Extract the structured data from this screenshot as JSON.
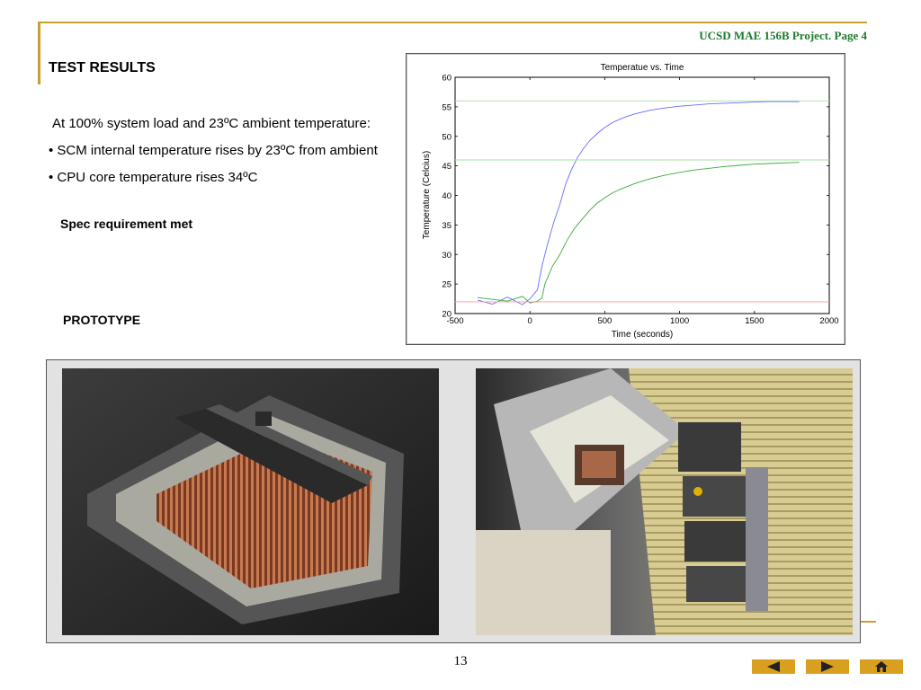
{
  "header": {
    "text": "UCSD MAE 156B Project. Page 4"
  },
  "title": "TEST RESULTS",
  "body": {
    "intro": "At 100% system load and 23ºC ambient temperature:",
    "bullet1": "•   SCM internal temperature  rises by 23ºC from ambient",
    "bullet2": "•   CPU core  temperature rises 34ºC",
    "spec": "Spec requirement met",
    "prototype": "PROTOTYPE"
  },
  "footer": {
    "page_number": "13"
  },
  "nav": {
    "prev_icon": "triangle-left-icon",
    "next_icon": "triangle-right-icon",
    "home_icon": "home-icon"
  },
  "photos": [
    {
      "subject": "copper-finned-heat-sink"
    },
    {
      "subject": "server-rack-module"
    }
  ],
  "chart_data": {
    "type": "line",
    "title": "Temperatue vs. Time",
    "xlabel": "Time (seconds)",
    "ylabel": "Temperature (Celcius)",
    "xlim": [
      -500,
      2000
    ],
    "ylim": [
      20,
      60
    ],
    "xticks": [
      -500,
      0,
      500,
      1000,
      1500,
      2000
    ],
    "yticks": [
      20,
      25,
      30,
      35,
      40,
      45,
      50,
      55,
      60
    ],
    "grid": false,
    "series": [
      {
        "color": "#6a6aff",
        "x": [
          -350,
          -250,
          -150,
          -50,
          0,
          50,
          80,
          120,
          160,
          200,
          240,
          280,
          320,
          360,
          400,
          450,
          500,
          550,
          600,
          650,
          700,
          750,
          800,
          900,
          1000,
          1100,
          1200,
          1300,
          1400,
          1500,
          1600,
          1700,
          1800
        ],
        "y": [
          22.3,
          21.6,
          22.8,
          21.5,
          22.5,
          24.0,
          28.0,
          32.0,
          35.5,
          38.5,
          42.0,
          44.5,
          46.5,
          48.0,
          49.3,
          50.5,
          51.5,
          52.3,
          52.9,
          53.4,
          53.8,
          54.1,
          54.4,
          54.8,
          55.1,
          55.3,
          55.5,
          55.6,
          55.7,
          55.8,
          55.9,
          55.9,
          55.9
        ]
      },
      {
        "color": "#3aa83a",
        "x": [
          -350,
          -250,
          -150,
          -50,
          0,
          50,
          80,
          100,
          150,
          200,
          250,
          300,
          350,
          400,
          450,
          500,
          550,
          600,
          650,
          700,
          750,
          800,
          900,
          1000,
          1100,
          1200,
          1300,
          1400,
          1500,
          1600,
          1700,
          1800
        ],
        "y": [
          22.7,
          22.4,
          22.1,
          22.9,
          21.8,
          22.1,
          22.6,
          25.0,
          28.0,
          30.0,
          32.5,
          34.5,
          36.0,
          37.5,
          38.7,
          39.6,
          40.4,
          41.0,
          41.5,
          42.0,
          42.4,
          42.8,
          43.4,
          43.9,
          44.3,
          44.6,
          44.9,
          45.1,
          45.3,
          45.4,
          45.5,
          45.6
        ]
      },
      {
        "color": "#a6e0a6",
        "x": [
          -500,
          2000
        ],
        "y": [
          56.0,
          56.0
        ]
      },
      {
        "color": "#a6e0a6",
        "x": [
          -500,
          2000
        ],
        "y": [
          46.0,
          46.0
        ]
      },
      {
        "color": "#ff9a9a",
        "x": [
          -500,
          2000
        ],
        "y": [
          22.0,
          22.0
        ]
      }
    ]
  }
}
